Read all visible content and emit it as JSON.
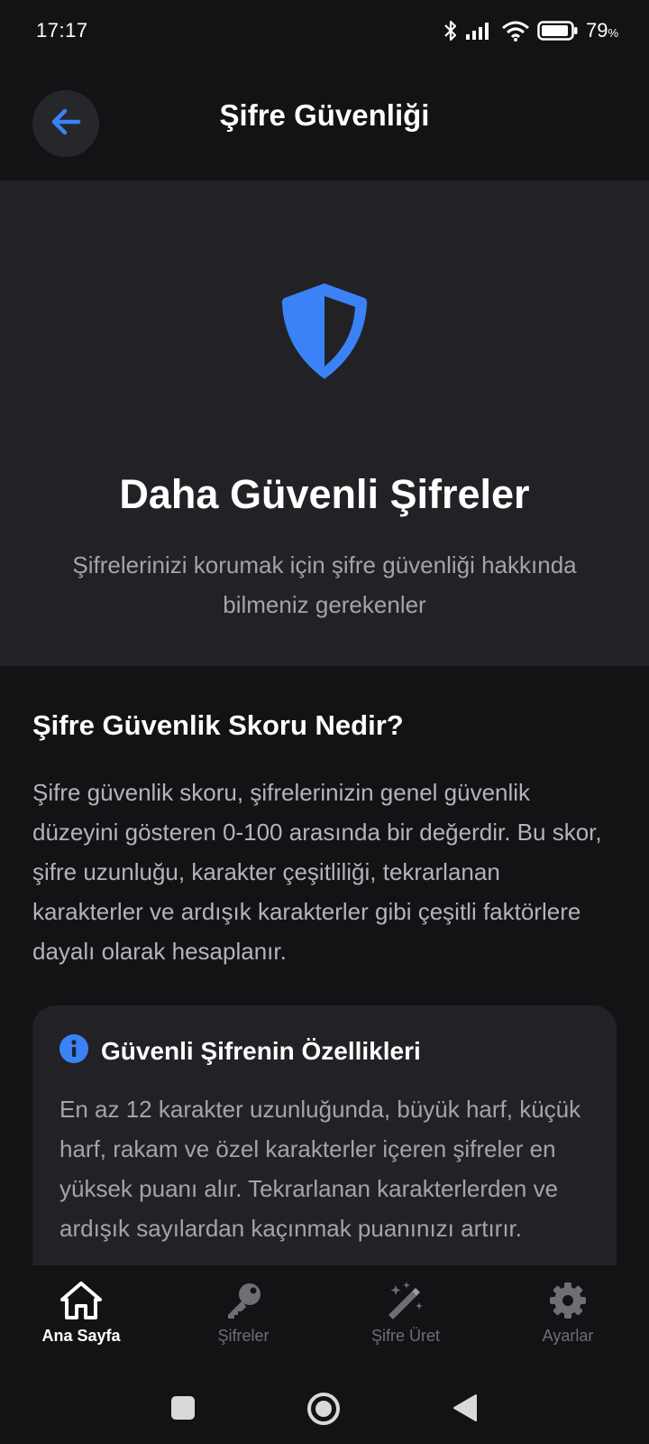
{
  "status_bar": {
    "time": "17:17",
    "battery_percent": "79",
    "battery_symbol": "%",
    "icons": [
      "bluetooth-icon",
      "signal-icon",
      "wifi-icon",
      "battery-icon"
    ]
  },
  "header": {
    "title": "Şifre Güvenliği",
    "back_icon": "arrow-left-icon"
  },
  "hero": {
    "icon": "shield-icon",
    "title": "Daha Güvenli Şifreler",
    "subtitle": "Şifrelerinizi korumak için şifre güvenliği hakkında bilmeniz gerekenler"
  },
  "section": {
    "title": "Şifre Güvenlik Skoru Nedir?",
    "body": "Şifre güvenlik skoru, şifrelerinizin genel güvenlik düzeyini gösteren 0-100 arasında bir değerdir. Bu skor, şifre uzunluğu, karakter çeşitliliği, tekrarlanan karakterler ve ardışık karakterler gibi çeşitli faktörlere dayalı olarak hesaplanır."
  },
  "info_card": {
    "icon": "info-icon",
    "title": "Güvenli Şifrenin Özellikleri",
    "body": "En az 12 karakter uzunluğunda, büyük harf, küçük harf, rakam ve özel karakterler içeren şifreler en yüksek puanı alır. Tekrarlanan karakterlerden ve ardışık sayılardan kaçınmak puanınızı artırır."
  },
  "bottom_nav": {
    "items": [
      {
        "label": "Ana Sayfa",
        "icon": "home-icon",
        "active": true
      },
      {
        "label": "Şifreler",
        "icon": "key-icon",
        "active": false
      },
      {
        "label": "Şifre Üret",
        "icon": "magic-wand-icon",
        "active": false
      },
      {
        "label": "Ayarlar",
        "icon": "gear-icon",
        "active": false
      }
    ]
  },
  "colors": {
    "accent": "#3b82f6",
    "background": "#131315",
    "surface": "#222226",
    "muted_text": "#a3a4ab"
  }
}
